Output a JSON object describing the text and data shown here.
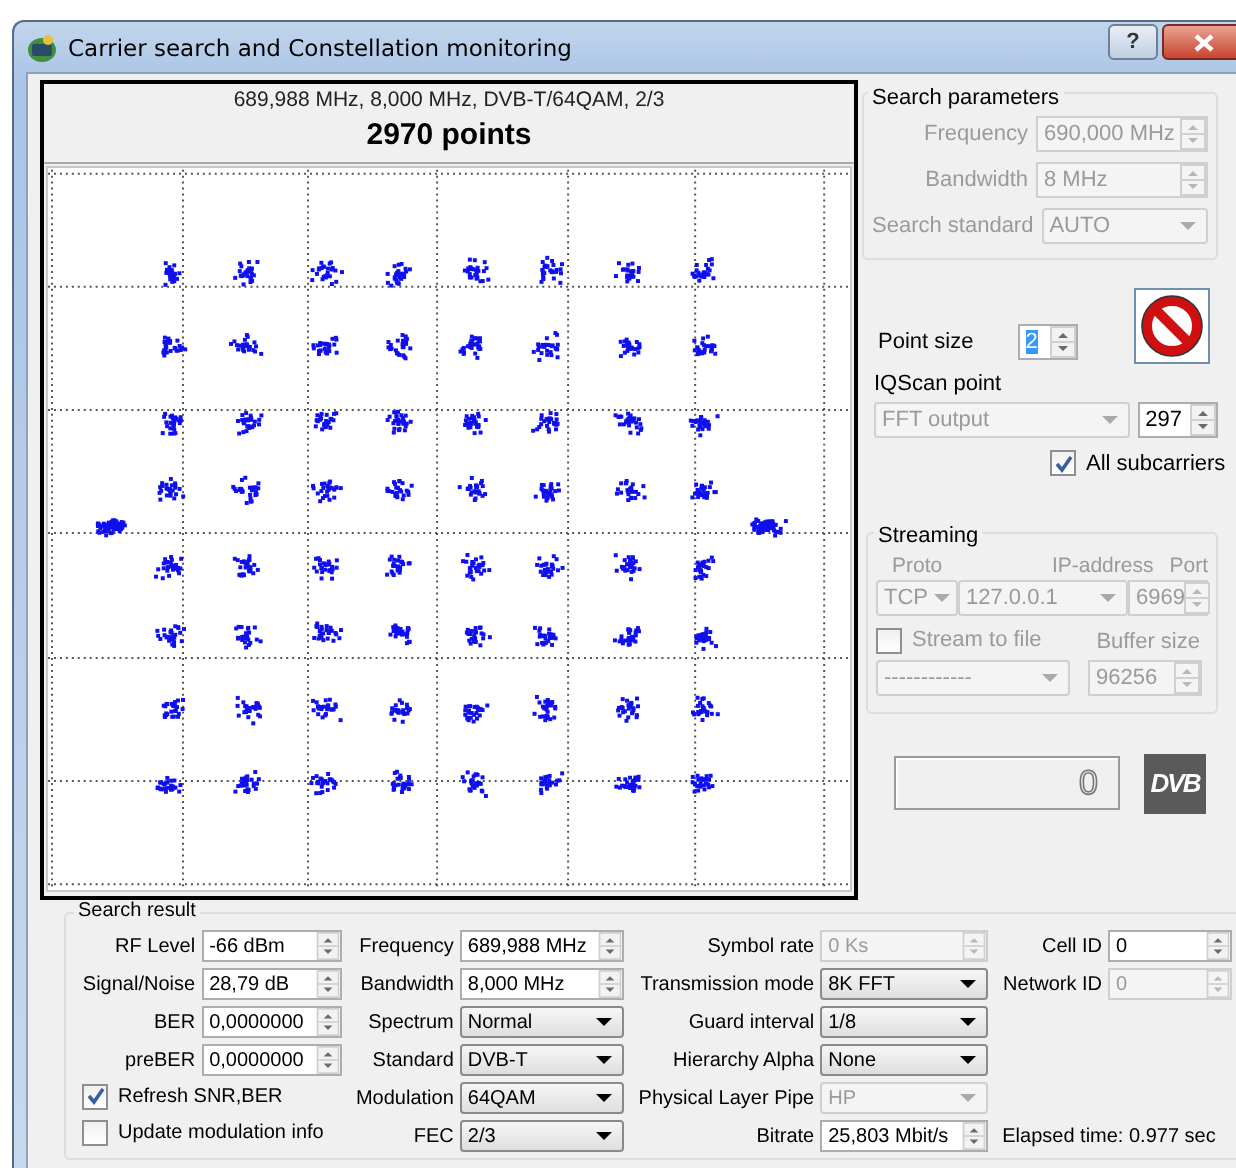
{
  "window": {
    "title": "Carrier search and Constellation monitoring",
    "help": "?"
  },
  "plot": {
    "subtitle": "689,988 MHz, 8,000 MHz, DVB-T/64QAM, 2/3",
    "title": "2970 points"
  },
  "search_parameters": {
    "title": "Search parameters",
    "fields": [
      {
        "label": "Frequency",
        "value": "690,000 MHz",
        "kind": "spin",
        "disabled": true
      },
      {
        "label": "Bandwidth",
        "value": "8 MHz",
        "kind": "spin",
        "disabled": true
      },
      {
        "label": "Search standard",
        "value": "AUTO",
        "kind": "combo",
        "disabled": true
      }
    ]
  },
  "point_size": {
    "label": "Point size",
    "value": "2"
  },
  "iq_scan": {
    "label": "IQScan point",
    "point": {
      "value": "FFT output",
      "disabled": true
    },
    "count": "297"
  },
  "all_subcarriers": {
    "label": "All subcarriers",
    "checked": true
  },
  "streaming": {
    "title": "Streaming",
    "disabled": true,
    "proto": {
      "label": "Proto",
      "value": "TCP"
    },
    "ip": {
      "label": "IP-address",
      "value": "127.0.0.1"
    },
    "port": {
      "label": "Port",
      "value": "6969"
    },
    "stream_to_file": {
      "label": "Stream to file",
      "checked": false
    },
    "file": {
      "value": "------------"
    },
    "buffer": {
      "label": "Buffer size",
      "value": "96256"
    }
  },
  "lcd": {
    "value": "0"
  },
  "logo": {
    "text": "DVB"
  },
  "search_result": {
    "title": "Search result",
    "columns": [
      [
        {
          "label": "RF Level",
          "value": "-66 dBm",
          "kind": "spin",
          "disabled": false
        },
        {
          "label": "Signal/Noise",
          "value": "28,79 dB",
          "kind": "spin",
          "disabled": false
        },
        {
          "label": "BER",
          "value": "0,0000000",
          "kind": "spin",
          "disabled": false
        },
        {
          "label": "preBER",
          "value": "0,0000000",
          "kind": "spin",
          "disabled": false
        },
        {
          "label": "Refresh SNR,BER",
          "kind": "check",
          "checked": true
        },
        {
          "label": "Update modulation info",
          "kind": "check",
          "checked": false
        }
      ],
      [
        {
          "label": "Frequency",
          "value": "689,988 MHz",
          "kind": "spin",
          "disabled": false
        },
        {
          "label": "Bandwidth",
          "value": "8,000 MHz",
          "kind": "spin",
          "disabled": false
        },
        {
          "label": "Spectrum",
          "value": "Normal",
          "kind": "combo",
          "disabled": false
        },
        {
          "label": "Standard",
          "value": "DVB-T",
          "kind": "combo",
          "disabled": false
        },
        {
          "label": "Modulation",
          "value": "64QAM",
          "kind": "combo",
          "disabled": false
        },
        {
          "label": "FEC",
          "value": "2/3",
          "kind": "combo",
          "disabled": false
        }
      ],
      [
        {
          "label": "Symbol rate",
          "value": "0 Ks",
          "kind": "spin",
          "disabled": true
        },
        {
          "label": "Transmission mode",
          "value": "8K FFT",
          "kind": "combo",
          "disabled": false
        },
        {
          "label": "Guard interval",
          "value": "1/8",
          "kind": "combo",
          "disabled": false
        },
        {
          "label": "Hierarchy Alpha",
          "value": "None",
          "kind": "combo",
          "disabled": false
        },
        {
          "label": "Physical Layer Pipe",
          "value": "HP",
          "kind": "combo",
          "disabled": true
        },
        {
          "label": "Bitrate",
          "value": "25,803 Mbit/s",
          "kind": "spin",
          "disabled": false
        }
      ],
      [
        {
          "label": "Cell ID",
          "value": "0",
          "kind": "spin",
          "disabled": false
        },
        {
          "label": "Network ID",
          "value": "0",
          "kind": "spin",
          "disabled": true
        }
      ]
    ],
    "elapsed": "Elapsed time: 0.977 sec"
  }
}
